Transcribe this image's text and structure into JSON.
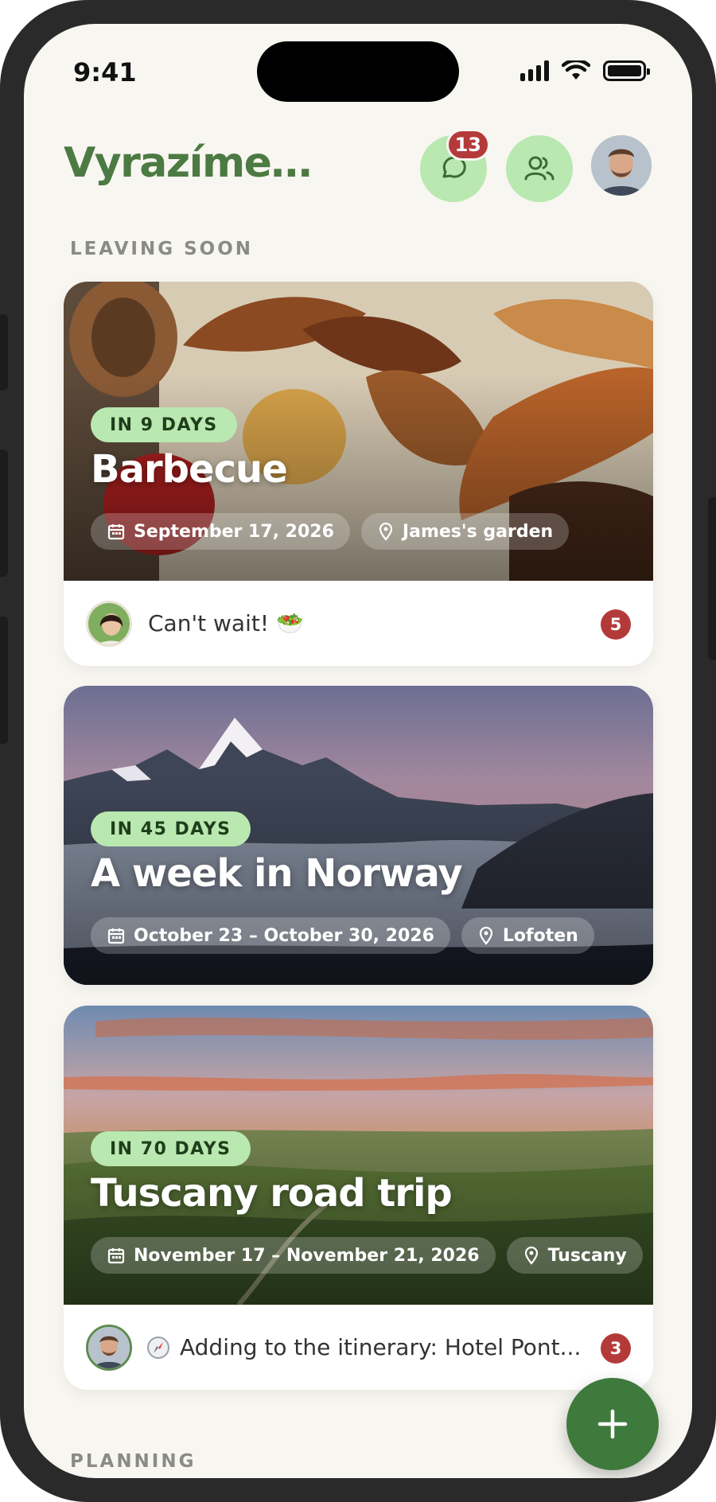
{
  "status_bar": {
    "time": "9:41"
  },
  "header": {
    "title": "Vyrazíme…",
    "chat_badge": "13",
    "icons": [
      "chat-icon",
      "friends-icon",
      "profile-avatar"
    ]
  },
  "sections": {
    "leaving_soon": "LEAVING SOON",
    "planning": "PLANNING"
  },
  "trips": [
    {
      "days": "IN 9 DAYS",
      "title": "Barbecue",
      "date": "September 17, 2026",
      "location": "James's garden",
      "footer": {
        "message": "Can't wait! 🥗",
        "count": "5"
      }
    },
    {
      "days": "IN 45 DAYS",
      "title": "A week in Norway",
      "date": "October 23 – October 30, 2026",
      "location": "Lofoten"
    },
    {
      "days": "IN 70 DAYS",
      "title": "Tuscany road trip",
      "date": "November 17 – November 21, 2026",
      "location": "Tuscany",
      "footer": {
        "message": "Adding to the itinerary: Hotel Pont...",
        "count": "3",
        "icon": "compass-icon"
      }
    }
  ],
  "colors": {
    "accent": "#4c7a43",
    "pill": "#b9e8b0",
    "badge": "#b43a3a",
    "fab": "#3e7a3c"
  }
}
